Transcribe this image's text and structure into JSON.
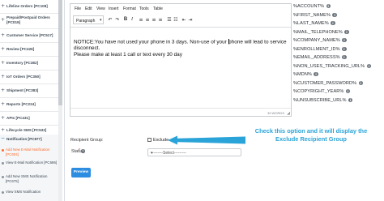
{
  "sidebar": {
    "items": [
      {
        "label": "Lifeline Orders [PC108]"
      },
      {
        "label": "Prepaid/Postpaid Orders [PC019]"
      },
      {
        "label": "Customer Service [PC517]"
      },
      {
        "label": "Review [PC426]"
      },
      {
        "label": "Inventory [PC382]"
      },
      {
        "label": "IoT Orders [PC350]"
      },
      {
        "label": "Shipment [PC383]"
      },
      {
        "label": "Reports [PC224]"
      },
      {
        "label": "APIs [PC431]"
      },
      {
        "label": "Lifecycle SMS [PC532]"
      },
      {
        "label": "Notification [PC877]"
      }
    ],
    "submenu": [
      {
        "label": "Add New E-Mail Notification [PC604]",
        "active": true
      },
      {
        "label": "View E-Mail Notification [PC686]"
      },
      {
        "label": "Add New SMS Notification [PC675]"
      },
      {
        "label": "View SMS Notification"
      }
    ]
  },
  "editor": {
    "menu": [
      "File",
      "Edit",
      "View",
      "Insert",
      "Format",
      "Tools",
      "Table"
    ],
    "format_value": "Paragraph",
    "toolbar_icons": [
      "undo-icon",
      "redo-icon",
      "bold-icon",
      "italic-icon",
      "align-left-icon",
      "align-center-icon",
      "align-right-icon",
      "align-justify-icon",
      "bullet-list-icon",
      "numbered-list-icon",
      "outdent-icon",
      "indent-icon"
    ],
    "content_part1": "NOTICE:You have not used your phone in 3 days. Non-use of your ",
    "content_part2": "phone will lead to service disconnect.",
    "content_line2": "Please make at least 1 call or text every 30 day",
    "word_count": "39 WORDS"
  },
  "tokens": [
    "%ACCOUNT%",
    "%FIRST_NAME%",
    "%LAST_NAME%",
    "%MAIL_TELEPHONE%",
    "%COMPANY_NAME%",
    "%ENROLLMENT_ID%",
    "%EMAIL_ADDRESS%",
    "%NON_USES_TRACKING_URL%",
    "%MDN%",
    "%CUSTOMER_PASSWORD%",
    "%COPYRIGHT_YEAR%",
    "%UNSUBSCRIBE_URL%"
  ],
  "form": {
    "recipient_label": "Recipient Group:",
    "exclude_label": "Exclude",
    "status_label": "Status",
    "status_required": "*",
    "status_value": "---------Select---------",
    "preview_label": "Preview"
  },
  "callout": {
    "line1": "Check this option and it will display the",
    "line2": "Exclude Recipient Group"
  },
  "colors": {
    "accent": "#2d8de0",
    "active_menu": "#ff6a2a",
    "callout": "#2aa4d8"
  }
}
